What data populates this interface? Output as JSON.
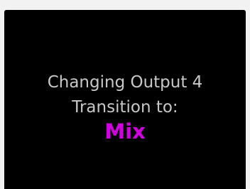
{
  "dialog": {
    "line1": "Changing Output 4",
    "line2": "Transition to:",
    "value": "Mix"
  },
  "colors": {
    "background": "#000000",
    "text": "#c8c8c8",
    "accent": "#d100e0",
    "frame": "#f2f2f2"
  }
}
